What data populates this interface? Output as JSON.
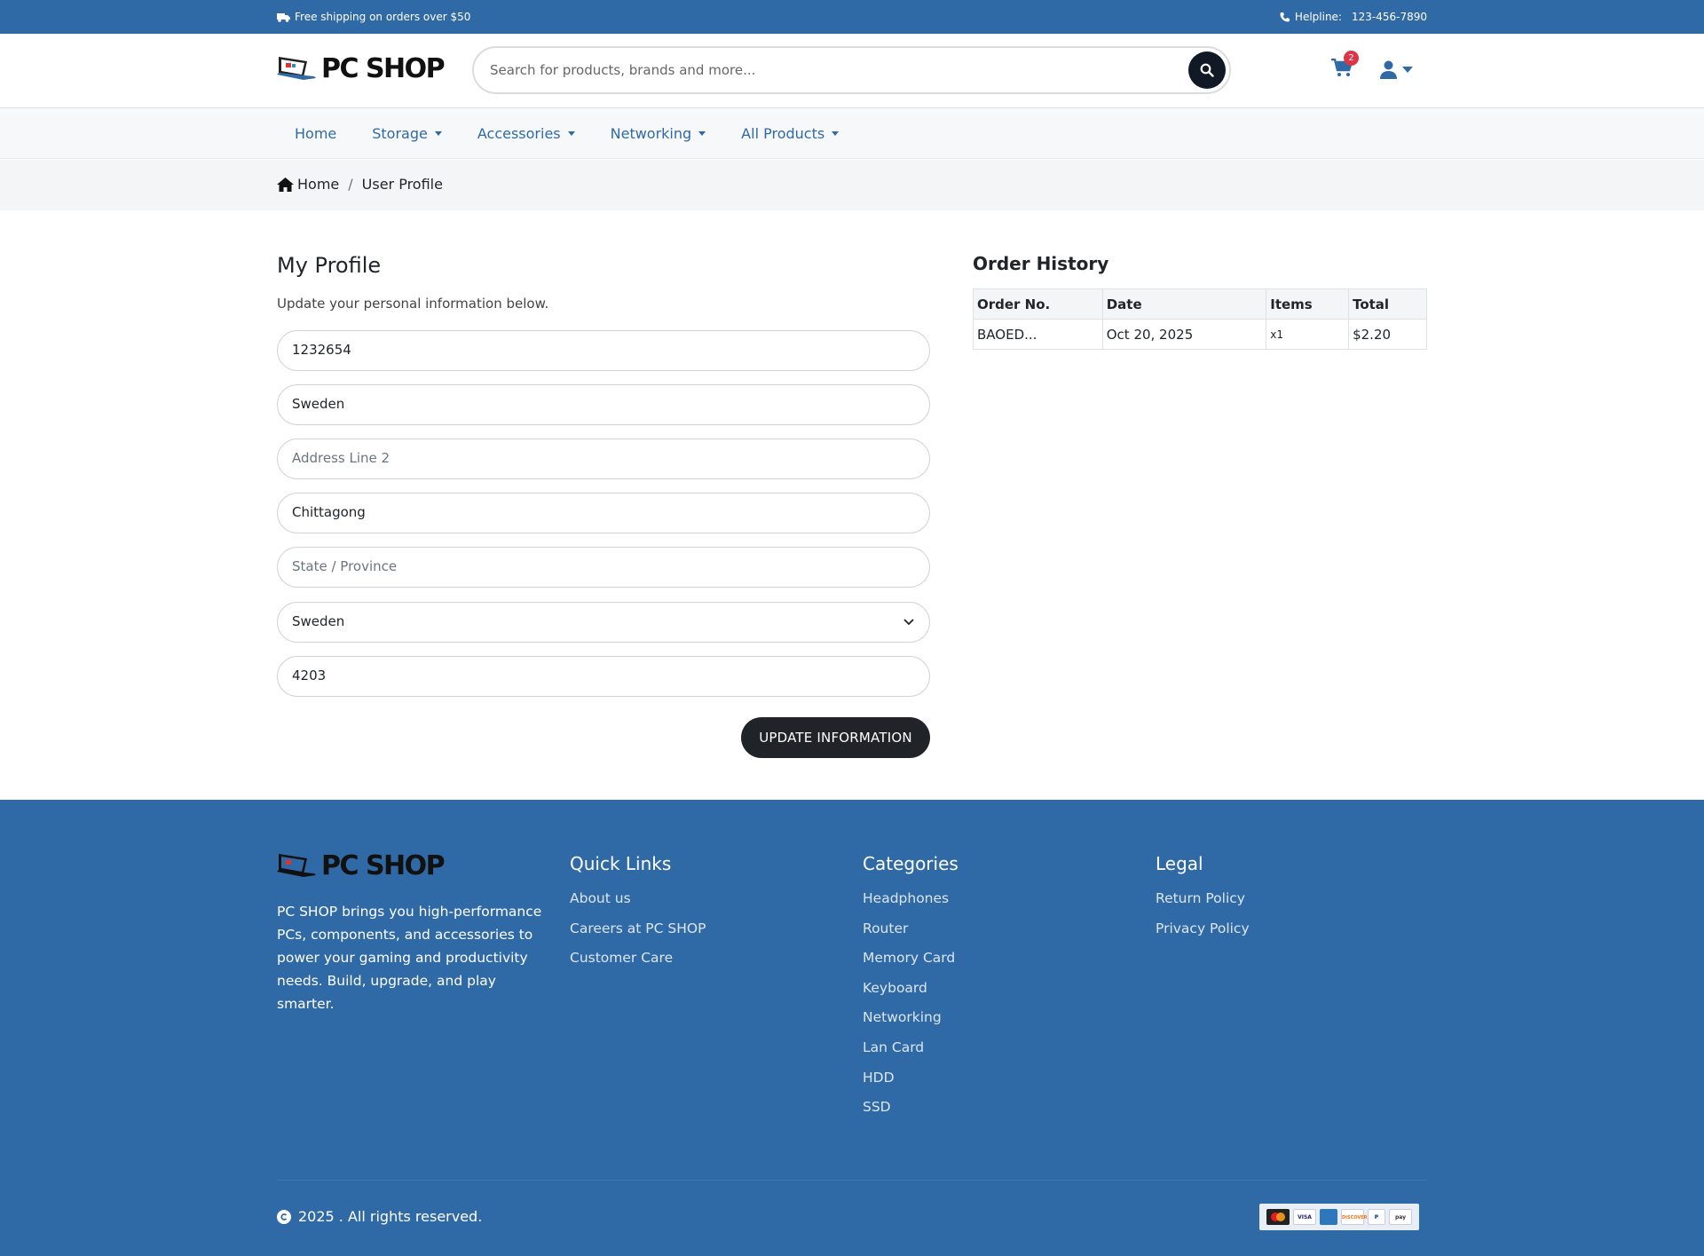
{
  "topbar": {
    "shipping": "Free shipping on orders over $50",
    "helpline_label": "Helpline:",
    "helpline_phone": "123-456-7890"
  },
  "brand": {
    "name": "PC SHOP"
  },
  "search": {
    "placeholder": "Search for products, brands and more..."
  },
  "cart": {
    "count": "2"
  },
  "nav": {
    "home": "Home",
    "storage": "Storage",
    "accessories": "Accessories",
    "networking": "Networking",
    "all_products": "All Products"
  },
  "breadcrumb": {
    "home": "Home",
    "sep": "/",
    "current": "User Profile"
  },
  "profile": {
    "title": "My Profile",
    "subtitle": "Update your personal information below.",
    "fields": {
      "phone": {
        "value": "1232654"
      },
      "address1": {
        "value": "Sweden"
      },
      "address2": {
        "placeholder": "Address Line 2"
      },
      "city": {
        "value": "Chittagong"
      },
      "state": {
        "placeholder": "State / Province"
      },
      "country": {
        "value": "Sweden"
      },
      "postal": {
        "value": "4203"
      }
    },
    "submit": "UPDATE INFORMATION"
  },
  "orders": {
    "title": "Order History",
    "headers": [
      "Order No.",
      "Date",
      "Items",
      "Total"
    ],
    "rows": [
      {
        "order_no": "BAOED...",
        "date": "Oct 20, 2025",
        "items": "x1",
        "total": "$2.20"
      }
    ]
  },
  "footer": {
    "brand": "PC SHOP",
    "description": "PC SHOP brings you high-performance PCs, components, and accessories to power your gaming and productivity needs. Build, upgrade, and play smarter.",
    "quick_links": {
      "title": "Quick Links",
      "items": [
        "About us",
        "Careers at PC SHOP",
        "Customer Care"
      ]
    },
    "categories": {
      "title": "Categories",
      "items": [
        "Headphones",
        "Router",
        "Memory Card",
        "Keyboard",
        "Networking",
        "Lan Card",
        "HDD",
        "SSD"
      ]
    },
    "legal": {
      "title": "Legal",
      "items": [
        "Return Policy",
        "Privacy Policy"
      ]
    },
    "copyright": "2025 . All rights reserved.",
    "payments": {
      "mastercard": "",
      "visa": "VISA",
      "amex": "",
      "discover": "DISCOVER",
      "paypal": "P",
      "pay": "pay"
    }
  },
  "colors": {
    "primary": "#306aa6",
    "dark": "#202428",
    "badge": "#dc3545"
  },
  "icons": {
    "truck": "truck-icon",
    "phone": "phone-icon",
    "search": "search-icon",
    "cart": "cart-icon",
    "user": "user-icon",
    "home": "home-icon",
    "chevron": "chevron-down-icon",
    "copyright": "copyright-icon"
  }
}
